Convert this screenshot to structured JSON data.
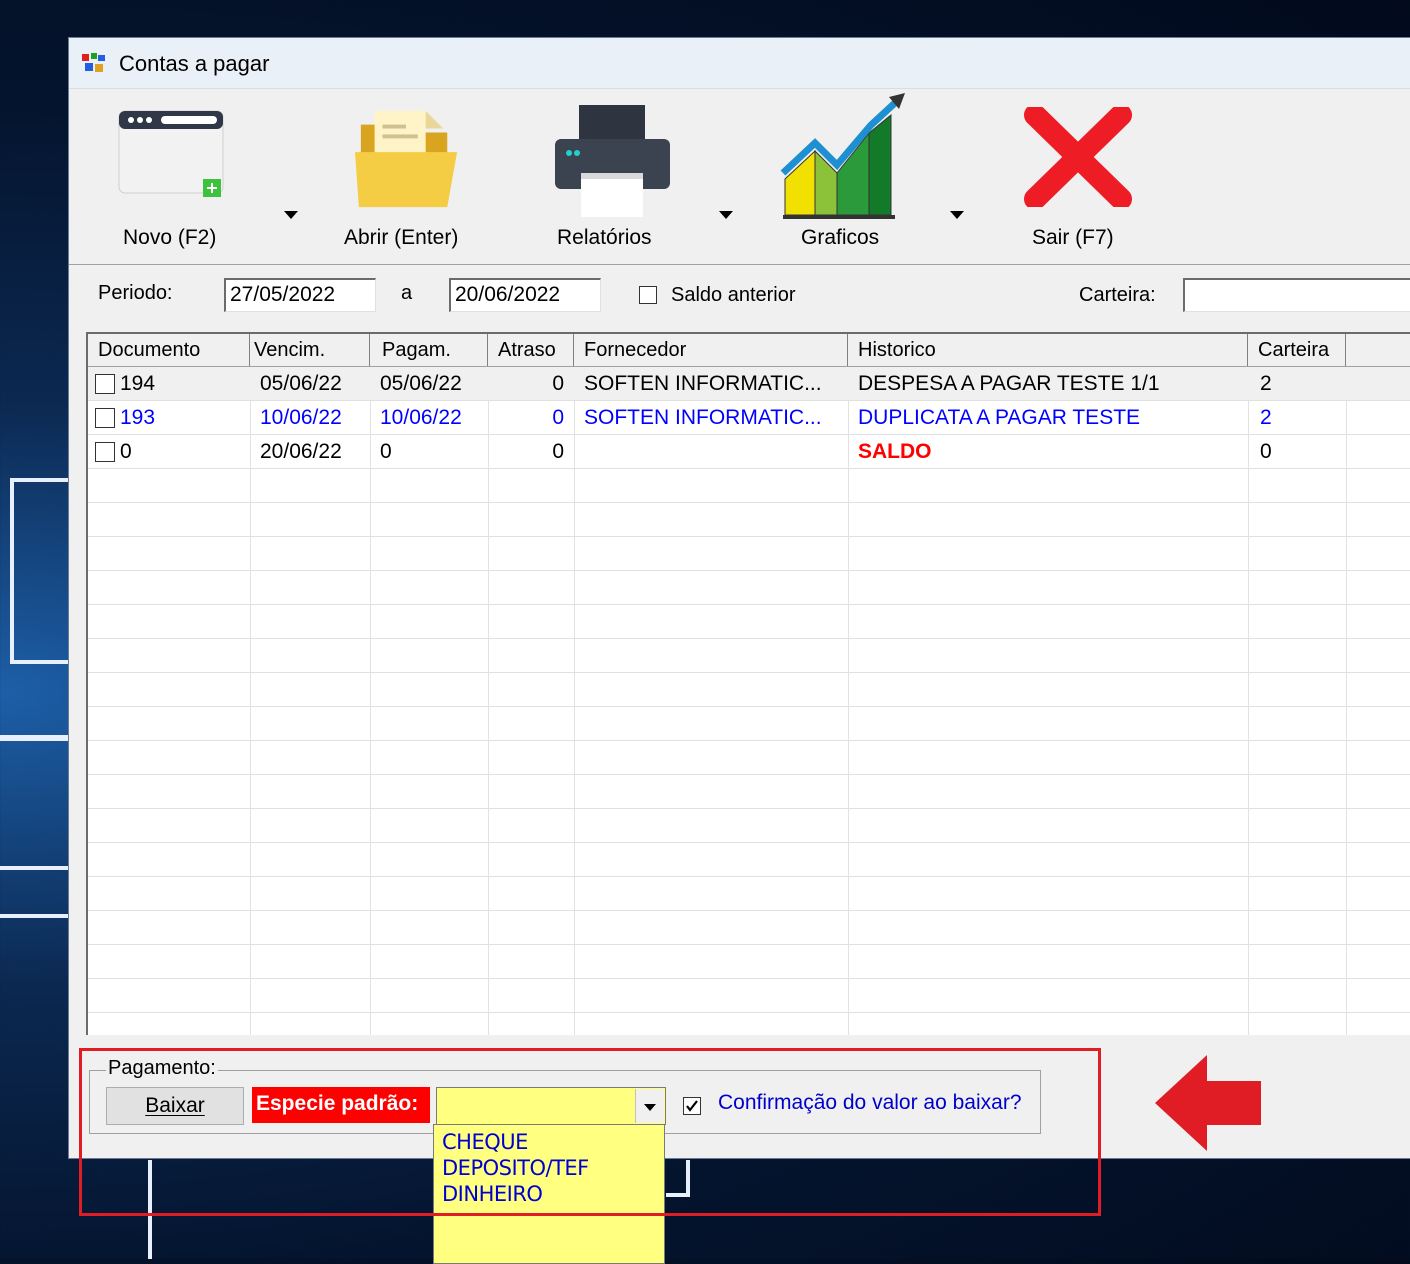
{
  "window": {
    "title": "Contas a pagar"
  },
  "toolbar": {
    "novo": "Novo (F2)",
    "abrir": "Abrir (Enter)",
    "relatorios": "Relatórios",
    "graficos": "Graficos",
    "sair": "Sair (F7)"
  },
  "filter": {
    "periodo_label": "Periodo:",
    "start_date": "27/05/2022",
    "a_label": "a",
    "end_date": "20/06/2022",
    "saldo_anterior_label": "Saldo anterior",
    "saldo_anterior_checked": false,
    "carteira_label": "Carteira:",
    "carteira_value": ""
  },
  "grid": {
    "columns": [
      "Documento",
      "Vencim.",
      "Pagam.",
      "Atraso",
      "Fornecedor",
      "Historico",
      "Carteira"
    ],
    "rows": [
      {
        "documento": "194",
        "vencim": "05/06/22",
        "pagam": "05/06/22",
        "atraso": "0",
        "fornecedor": "SOFTEN INFORMATIC...",
        "historico": "DESPESA A PAGAR TESTE 1/1",
        "carteira": "2",
        "color": "#000000"
      },
      {
        "documento": "193",
        "vencim": "10/06/22",
        "pagam": "10/06/22",
        "atraso": "0",
        "fornecedor": "SOFTEN INFORMATIC...",
        "historico": "DUPLICATA A PAGAR TESTE",
        "carteira": "2",
        "color": "#0000ff"
      },
      {
        "documento": "0",
        "vencim": "20/06/22",
        "pagam": "0",
        "atraso": "0",
        "fornecedor": "",
        "historico": "SALDO",
        "carteira": "0",
        "color": "#000000",
        "historico_color": "#ff0000"
      }
    ]
  },
  "pagamento": {
    "group_label": "Pagamento:",
    "baixar_label": "Baixar",
    "especie_label": "Especie padrão:",
    "especie_value": "",
    "confirm_label": "Confirmação do valor ao baixar?",
    "confirm_checked": true,
    "options": [
      "CHEQUE",
      "DEPOSITO/TEF",
      "DINHEIRO"
    ]
  },
  "colors": {
    "highlight_box": "#e01c24",
    "arrow": "#e01c24",
    "combo_bg": "#ffff80",
    "especie_bg": "#ff0000"
  }
}
